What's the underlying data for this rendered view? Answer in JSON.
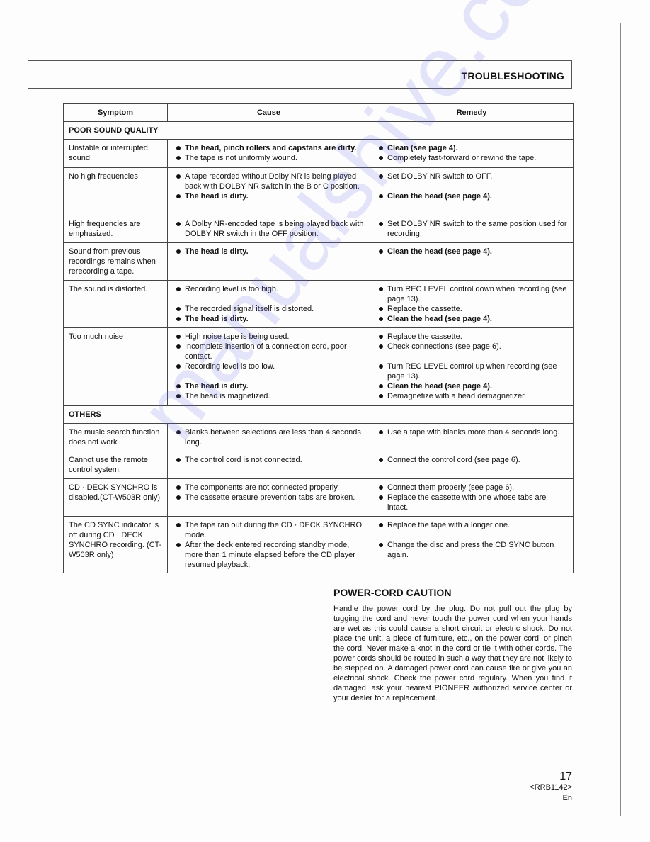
{
  "header": {
    "title": "TROUBLESHOOTING"
  },
  "table": {
    "columns": [
      "Symptom",
      "Cause",
      "Remedy"
    ],
    "sections": [
      {
        "title": "POOR SOUND QUALITY",
        "rows": [
          {
            "symptom": "Unstable or interrupted sound",
            "causes": [
              {
                "text": "The head, pinch rollers and capstans are dirty.",
                "bold": true
              },
              {
                "text": "The tape is not uniformly wound.",
                "bold": false
              }
            ],
            "remedies": [
              {
                "text": "Clean (see page 4).",
                "bold": true
              },
              {
                "text": "Completely fast-forward or rewind the tape.",
                "bold": false
              }
            ]
          },
          {
            "symptom": "No high frequencies",
            "causes": [
              {
                "text": "A tape recorded without Dolby NR is being played back with DOLBY NR switch in the B or C position.",
                "bold": false
              },
              {
                "text": "The head is dirty.",
                "bold": true
              }
            ],
            "remedies": [
              {
                "text": "Set DOLBY NR switch to OFF.",
                "bold": false
              },
              {
                "text": "Clean the head (see page 4).",
                "bold": true
              }
            ]
          },
          {
            "symptom": "High frequencies are emphasized.",
            "causes": [
              {
                "text": "A Dolby NR-encoded tape is being played back with DOLBY NR switch in the OFF position.",
                "bold": false
              }
            ],
            "remedies": [
              {
                "text": "Set DOLBY NR switch to the same position used for recording.",
                "bold": false
              }
            ]
          },
          {
            "symptom": "Sound from previous recordings remains when rerecording a tape.",
            "causes": [
              {
                "text": "The head is dirty.",
                "bold": true
              }
            ],
            "remedies": [
              {
                "text": "Clean the head (see page 4).",
                "bold": true
              }
            ]
          },
          {
            "symptom": "The sound is distorted.",
            "causes": [
              {
                "text": "Recording level is too high.",
                "bold": false
              },
              {
                "text": "The recorded signal itself is distorted.",
                "bold": false
              },
              {
                "text": "The head is dirty.",
                "bold": true
              }
            ],
            "remedies": [
              {
                "text": "Turn REC LEVEL control down when recording (see page 13).",
                "bold": false
              },
              {
                "text": "Replace the cassette.",
                "bold": false
              },
              {
                "text": "Clean the head (see page 4).",
                "bold": true
              }
            ]
          },
          {
            "symptom": "Too much noise",
            "causes": [
              {
                "text": "High noise tape is being used.",
                "bold": false
              },
              {
                "text": "Incomplete insertion of a connection cord, poor contact.",
                "bold": false
              },
              {
                "text": "Recording level is too low.",
                "bold": false
              },
              {
                "text": "The head is dirty.",
                "bold": true
              },
              {
                "text": "The head is magnetized.",
                "bold": false
              }
            ],
            "remedies": [
              {
                "text": "Replace the cassette.",
                "bold": false
              },
              {
                "text": "Check connections (see page 6).",
                "bold": false
              },
              {
                "text": "Turn REC LEVEL control up when recording (see page 13).",
                "bold": false
              },
              {
                "text": "Clean the head (see page 4).",
                "bold": true
              },
              {
                "text": "Demagnetize with a head demagnetizer.",
                "bold": false
              }
            ]
          }
        ]
      },
      {
        "title": "OTHERS",
        "rows": [
          {
            "symptom": "The music search function does not work.",
            "causes": [
              {
                "text": "Blanks between selections are less than 4 seconds long.",
                "bold": false
              }
            ],
            "remedies": [
              {
                "text": "Use a tape with blanks more than 4 seconds long.",
                "bold": false
              }
            ]
          },
          {
            "symptom": "Cannot use the remote control system.",
            "causes": [
              {
                "text": "The control cord is not connected.",
                "bold": false
              }
            ],
            "remedies": [
              {
                "text": "Connect the control cord (see page 6).",
                "bold": false
              }
            ]
          },
          {
            "symptom": "CD · DECK SYNCHRO is disabled.(CT-W503R only)",
            "causes": [
              {
                "text": "The components are not connected properly.",
                "bold": false
              },
              {
                "text": "The cassette erasure prevention tabs are broken.",
                "bold": false
              }
            ],
            "remedies": [
              {
                "text": "Connect them properly (see page 6).",
                "bold": false
              },
              {
                "text": "Replace the cassette with one whose tabs are intact.",
                "bold": false
              }
            ]
          },
          {
            "symptom": "The CD SYNC indicator is off during CD · DECK SYNCHRO recording. (CT-W503R only)",
            "causes": [
              {
                "text": "The tape ran out during the CD · DECK SYNCHRO mode.",
                "bold": false
              },
              {
                "text": "After the deck entered recording standby mode, more than 1 minute elapsed before the CD player resumed playback.",
                "bold": false
              }
            ],
            "remedies": [
              {
                "text": "Replace the tape with a longer one.",
                "bold": false
              },
              {
                "text": "Change the disc and press the CD SYNC button again.",
                "bold": false
              }
            ]
          }
        ]
      }
    ]
  },
  "power_cord": {
    "title": "POWER-CORD CAUTION",
    "body": "Handle the power cord by the plug. Do not pull out the plug by tugging the cord and never touch the power cord when your hands are wet as this could cause a short circuit or electric shock. Do not place the unit, a piece of furniture, etc., on the power cord, or pinch the cord. Never make a knot in the cord or tie it with other cords. The power cords should be routed in such a way that they are not likely to be stepped on. A damaged power cord can cause fire or give you an electrical shock. Check the power cord regulary. When you find it damaged, ask your nearest PIONEER authorized service center or your dealer for a replacement."
  },
  "footer": {
    "page_number": "17",
    "doc_code": "<RRB1142>",
    "language": "En"
  },
  "watermark": {
    "text": "manualshive.com",
    "color": "#6e6eeb"
  }
}
